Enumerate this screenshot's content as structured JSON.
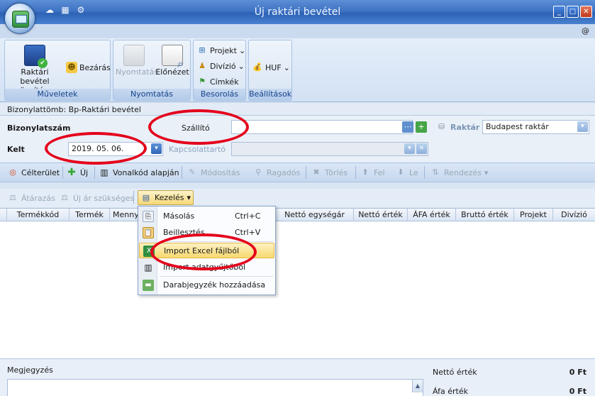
{
  "window": {
    "title": "Új raktári bevétel",
    "corner_mark": "@"
  },
  "ribbon": {
    "groups": {
      "muveletek": "Műveletek",
      "nyomtatas": "Nyomtatás",
      "besorolas": "Besorolás",
      "beallitasok": "Beállítások"
    },
    "buttons": {
      "save_line1": "Raktári bevétel",
      "save_line2": "rögzítése",
      "close": "Bezárás",
      "print": "Nyomtatás",
      "preview": "Előnézet",
      "project": "Projekt",
      "division": "Divízió",
      "labels": "Címkék",
      "currency": "HUF"
    }
  },
  "document_block": "Bizonylattömb: Bp-Raktári bevétel",
  "form": {
    "doc_number_label": "Bizonylatszám",
    "supplier_label": "Szállító",
    "supplier_value": "",
    "warehouse_label": "Raktár",
    "warehouse_value": "Budapest raktár",
    "date_label": "Kelt",
    "date_value": "2019. 05. 06.",
    "contact_label": "Kapcsolattartó",
    "contact_value": ""
  },
  "toolbar1": {
    "target": "Célterület",
    "new": "Új",
    "barcode": "Vonalkód alapján",
    "modify": "Módosítás",
    "paste": "Ragadós",
    "delete": "Törlés",
    "up": "Fel",
    "down": "Le",
    "sort": "Rendezés"
  },
  "toolbar2": {
    "reprice": "Átárazás",
    "new_price": "Új ár szükséges",
    "manage": "Kezelés"
  },
  "grid": {
    "columns": [
      "Termékkód",
      "Termék",
      "Mennyi",
      "Nettó egységár",
      "Nettó érték",
      "ÁFA érték",
      "Bruttó érték",
      "Projekt",
      "Divízió"
    ]
  },
  "menu": {
    "items": [
      {
        "label": "Másolás",
        "shortcut": "Ctrl+C"
      },
      {
        "label": "Beillesztés",
        "shortcut": "Ctrl+V"
      },
      {
        "label": "Import Excel fájlból",
        "shortcut": ""
      },
      {
        "label": "Import adatgyűjtőből",
        "shortcut": ""
      },
      {
        "label": "Darabjegyzék hozzáadása",
        "shortcut": ""
      }
    ]
  },
  "bottom": {
    "notes_label": "Megjegyzés",
    "net_label": "Nettó érték",
    "net_value": "0 Ft",
    "vat_label": "Áfa érték",
    "vat_value": "0 Ft"
  },
  "colors": {
    "title_bar": "#3f73c4",
    "highlight_ellipse": "#e4001b",
    "menu_hover": "#f8d96f"
  }
}
